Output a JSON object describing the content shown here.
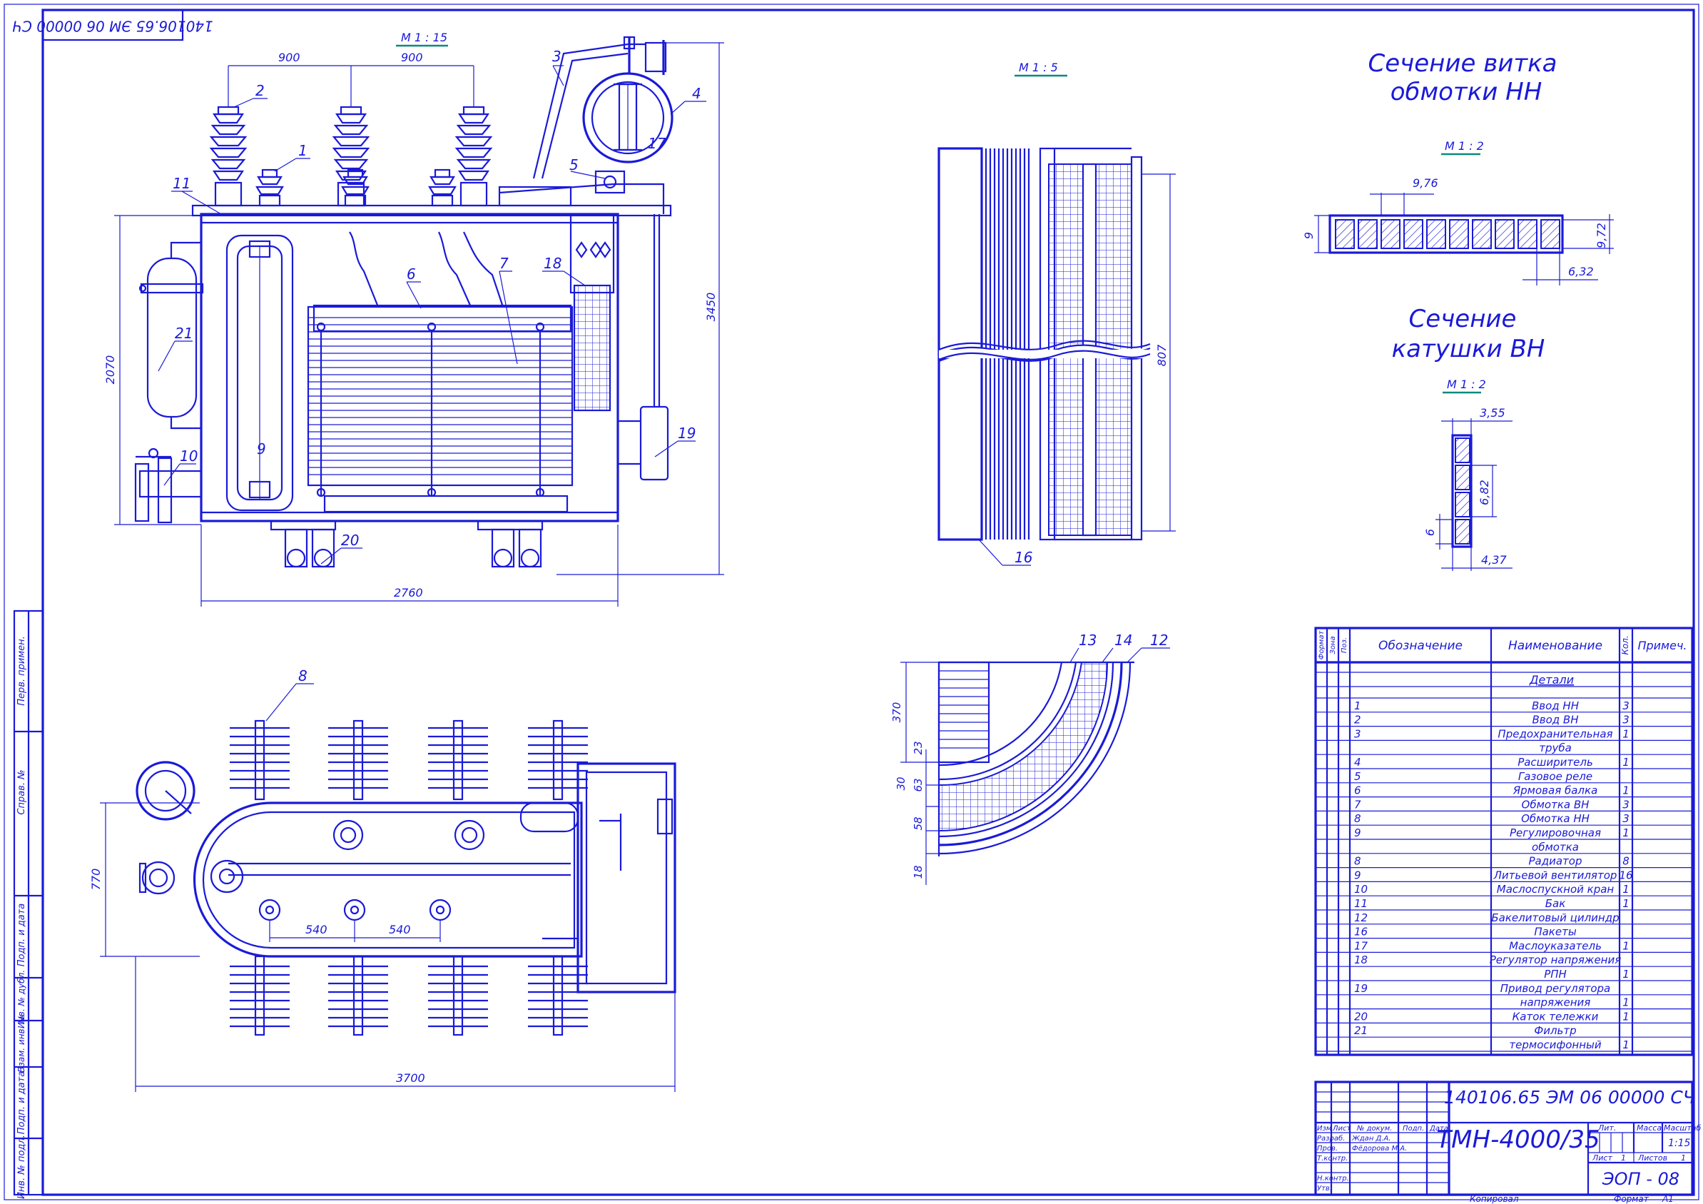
{
  "document": {
    "code_stamp": "140106.65 ЭМ 06 00000 СЧ",
    "title": "ТМН-4000/35",
    "sheet_label": "ЭОП - 08",
    "copied_label": "Копировал",
    "format_label": "Формат",
    "format_value": "А1"
  },
  "views": {
    "front": {
      "scale": "М 1 : 15",
      "dims": {
        "d900a": "900",
        "d900b": "900",
        "d2760": "2760",
        "d3450": "3450",
        "d2070": "2070"
      },
      "callouts": [
        "1",
        "2",
        "3",
        "4",
        "5",
        "6",
        "7",
        "9",
        "10",
        "11",
        "17",
        "18",
        "19",
        "20",
        "21"
      ]
    },
    "plan": {
      "dims": {
        "d540a": "540",
        "d540b": "540",
        "d770": "770",
        "d3700": "3700"
      },
      "callouts": [
        "8"
      ]
    },
    "coil_section": {
      "scale": "М 1 : 5",
      "dims": {
        "d807": "807"
      },
      "callouts": [
        "16"
      ]
    },
    "quarter_section": {
      "dims": {
        "d370": "370",
        "d23": "23",
        "d30": "30",
        "d63": "63",
        "d58": "58",
        "d18": "18"
      },
      "callouts": [
        "13",
        "14",
        "12"
      ]
    },
    "section_lv": {
      "title_line1": "Сечение витка",
      "title_line2": "обмотки НН",
      "scale": "М 1 : 2",
      "dims": {
        "d976": "9,76",
        "d9": "9",
        "d972": "9,72",
        "d632": "6,32"
      }
    },
    "section_hv": {
      "title_line1": "Сечение",
      "title_line2": "катушки ВН",
      "scale": "М 1 : 2",
      "dims": {
        "d355": "3,55",
        "d682": "6,82",
        "d6": "6",
        "d437": "4,37"
      }
    }
  },
  "side_stamps": [
    "Перв. примен.",
    "Справ. №",
    "Подп. и дата",
    "Инв. № дубл.",
    "Взам. инв. №",
    "Подп. и дата",
    "Инв. № подл."
  ],
  "spec_table": {
    "headers": {
      "format": "Формат",
      "zone": "Зона",
      "pos": "Поз.",
      "designation": "Обозначение",
      "name": "Наименование",
      "qty": "Кол.",
      "note": "Примеч."
    },
    "section": "Детали",
    "rows": [
      {
        "pos": "1",
        "name": "Ввод НН",
        "qty": "3"
      },
      {
        "pos": "2",
        "name": "Ввод ВН",
        "qty": "3"
      },
      {
        "pos": "3",
        "name": "Предохранительная",
        "qty": "1"
      },
      {
        "pos": "",
        "name": "труба",
        "qty": ""
      },
      {
        "pos": "4",
        "name": "Расширитель",
        "qty": "1"
      },
      {
        "pos": "5",
        "name": "Газовое реле",
        "qty": ""
      },
      {
        "pos": "6",
        "name": "Ярмовая балка",
        "qty": "1"
      },
      {
        "pos": "7",
        "name": "Обмотка ВН",
        "qty": "3"
      },
      {
        "pos": "8",
        "name": "Обмотка НН",
        "qty": "3"
      },
      {
        "pos": "9",
        "name": "Регулировочная",
        "qty": "1"
      },
      {
        "pos": "",
        "name": "обмотка",
        "qty": ""
      },
      {
        "pos": "8",
        "name": "Радиатор",
        "qty": "8"
      },
      {
        "pos": "9",
        "name": "Литьевой вентилятор",
        "qty": "16"
      },
      {
        "pos": "10",
        "name": "Маслоспускной кран",
        "qty": "1"
      },
      {
        "pos": "11",
        "name": "Бак",
        "qty": "1"
      },
      {
        "pos": "12",
        "name": "Бакелитовый цилиндр",
        "qty": ""
      },
      {
        "pos": "16",
        "name": "Пакеты",
        "qty": ""
      },
      {
        "pos": "17",
        "name": "Маслоуказатель",
        "qty": "1"
      },
      {
        "pos": "18",
        "name": "Регулятор напряжения",
        "qty": ""
      },
      {
        "pos": "",
        "name": "РПН",
        "qty": "1"
      },
      {
        "pos": "19",
        "name": "Привод регулятора",
        "qty": ""
      },
      {
        "pos": "",
        "name": "напряжения",
        "qty": "1"
      },
      {
        "pos": "20",
        "name": "Каток тележки",
        "qty": "1"
      },
      {
        "pos": "21",
        "name": "Фильтр",
        "qty": ""
      },
      {
        "pos": "",
        "name": "термосифонный",
        "qty": "1"
      }
    ]
  },
  "title_block": {
    "code": "140106.65 ЭМ 06 00000 СЧ",
    "product": "ТМН-4000/35",
    "org": "ЭОП - 08",
    "col_headers": [
      "Изм",
      "Лист",
      "№ докум.",
      "Подп.",
      "Дата"
    ],
    "roles": [
      "Разраб.",
      "Пров.",
      "Т.контр.",
      "",
      "Н.контр.",
      "Утв."
    ],
    "people": [
      "Ждан Д.А.",
      "Фёдорова М.А.",
      "",
      "",
      "",
      ""
    ],
    "lit_label": "Лит.",
    "mass_label": "Масса",
    "scale_label": "Масштаб",
    "scale_value": "1:15",
    "sheet_label": "Лист",
    "sheet_value": "1",
    "sheets_label": "Листов",
    "sheets_value": "1"
  }
}
